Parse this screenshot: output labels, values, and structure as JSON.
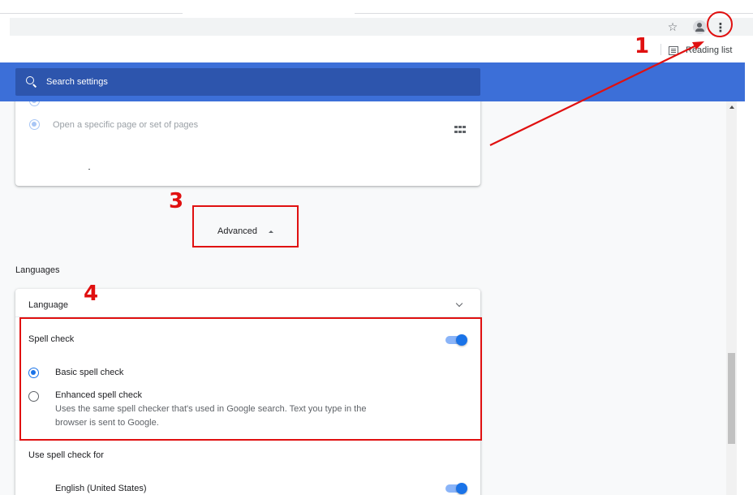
{
  "browser": {
    "bookmarks_bar": {
      "reading_list_label": "Reading list"
    }
  },
  "search": {
    "placeholder": "Search settings"
  },
  "on_startup": {
    "option_specific_page": "Open a specific page or set of pages"
  },
  "advanced": {
    "label": "Advanced"
  },
  "languages": {
    "section_title": "Languages",
    "language_row_label": "Language",
    "spell_check_label": "Spell check",
    "spell_check_enabled": true,
    "basic_spell_check": "Basic spell check",
    "enhanced_spell_check": "Enhanced spell check",
    "enhanced_description": "Uses the same spell checker that's used in Google search. Text you type in the browser is sent to Google.",
    "selected_mode": "basic",
    "use_spell_check_for": "Use spell check for",
    "languages_list": [
      {
        "name": "English (United States)",
        "enabled": true
      }
    ]
  },
  "annotations": {
    "step_1": "1",
    "step_3": "3",
    "step_4": "4"
  },
  "colors": {
    "header_blue": "#3c6fd8",
    "search_box": "#2d55ad",
    "accent": "#1a73e8",
    "annotation_red": "#e01010"
  }
}
